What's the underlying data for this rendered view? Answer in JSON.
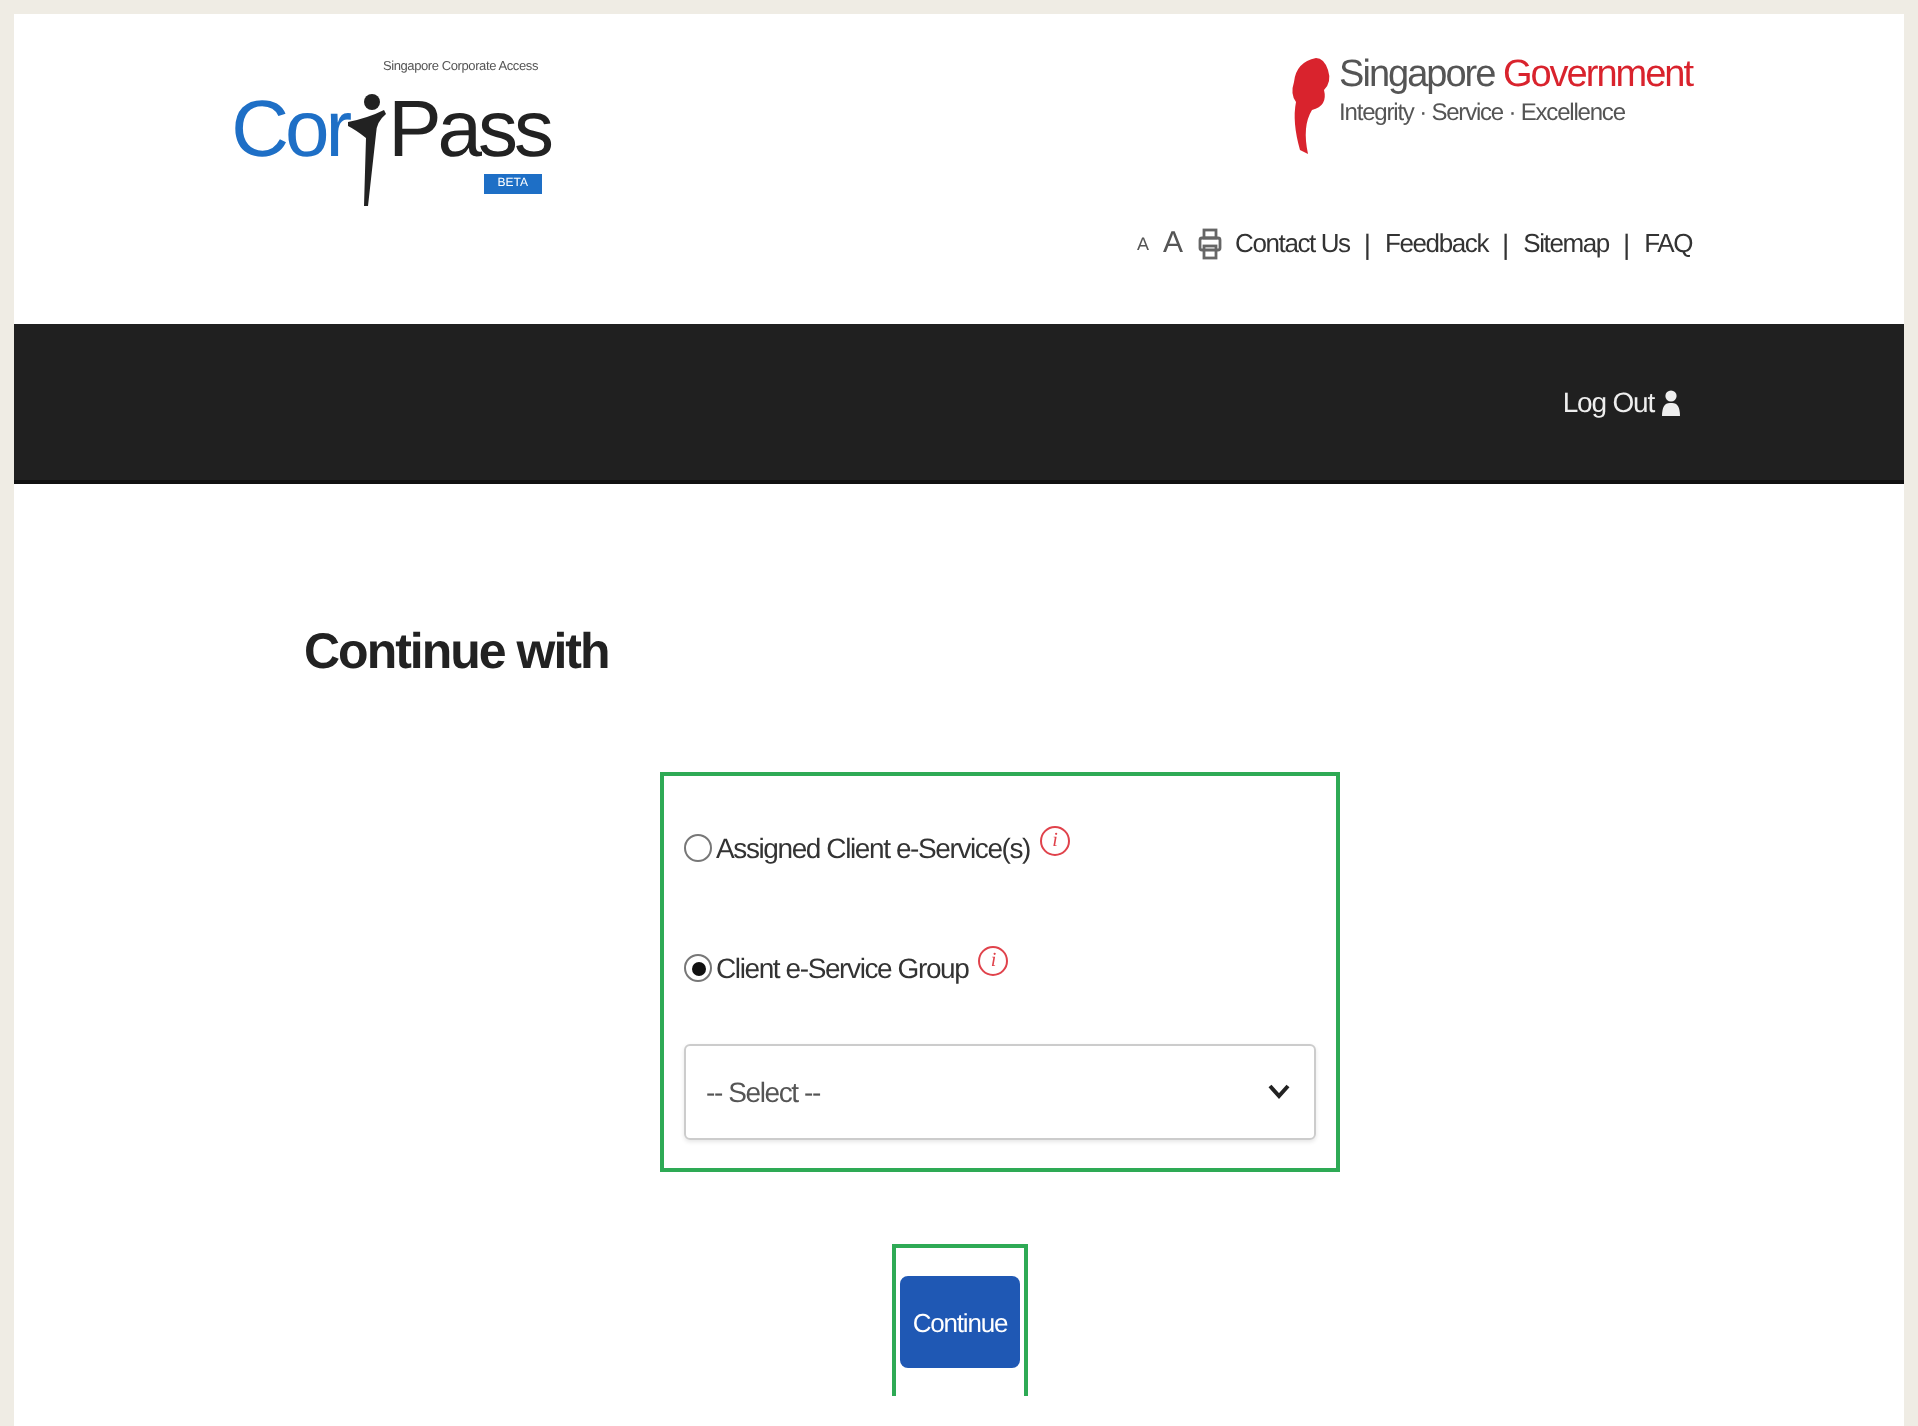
{
  "logo": {
    "tagline": "Singapore Corporate Access",
    "left": "Cor",
    "right": "Pass",
    "badge": "BETA"
  },
  "government": {
    "name": "Singapore",
    "highlight": "Government",
    "motto": "Integrity · Service · Excellence"
  },
  "utility": {
    "small_font": "A",
    "large_font": "A",
    "links": [
      "Contact Us",
      "Feedback",
      "Sitemap",
      "FAQ"
    ],
    "separators": [
      "|",
      "|",
      "|"
    ]
  },
  "navbar": {
    "logout": "Log Out"
  },
  "heading": "Continue with",
  "options": [
    {
      "label": "Assigned Client e-Service(s)",
      "selected": false,
      "info": "i"
    },
    {
      "label": "Client e-Service Group",
      "selected": true,
      "info": "i"
    }
  ],
  "select": {
    "placeholder": "-- Select --"
  },
  "button": "Continue"
}
